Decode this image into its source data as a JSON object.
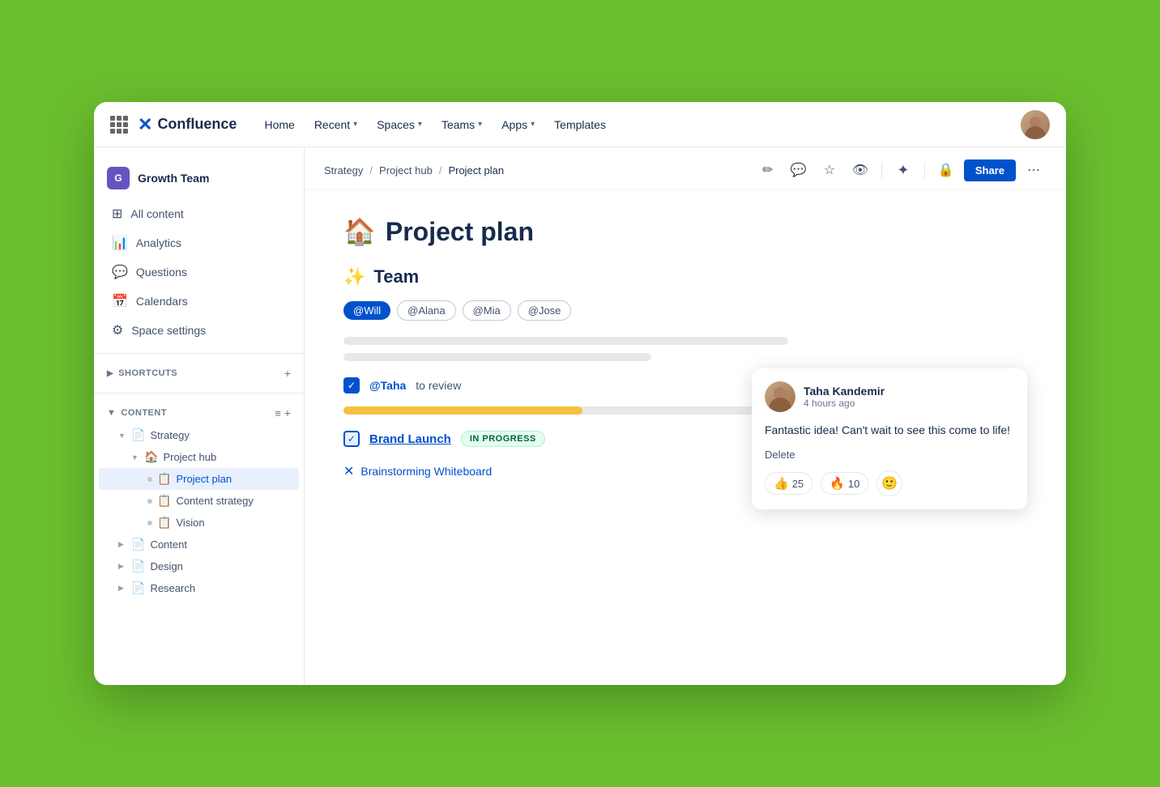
{
  "app": {
    "name": "Confluence",
    "logo_symbol": "✕"
  },
  "topnav": {
    "grid_label": "App grid",
    "nav_items": [
      {
        "label": "Home",
        "has_chevron": false
      },
      {
        "label": "Recent",
        "has_chevron": true
      },
      {
        "label": "Spaces",
        "has_chevron": true
      },
      {
        "label": "Teams",
        "has_chevron": true
      },
      {
        "label": "Apps",
        "has_chevron": true
      },
      {
        "label": "Templates",
        "has_chevron": false
      }
    ]
  },
  "sidebar": {
    "space_name": "Growth Team",
    "space_initial": "G",
    "nav_items": [
      {
        "icon": "⊞",
        "label": "All content"
      },
      {
        "icon": "📊",
        "label": "Analytics"
      },
      {
        "icon": "💬",
        "label": "Questions"
      },
      {
        "icon": "📅",
        "label": "Calendars"
      },
      {
        "icon": "⚙",
        "label": "Space settings"
      }
    ],
    "shortcuts_label": "SHORTCUTS",
    "content_label": "CONTENT",
    "tree": [
      {
        "level": 0,
        "label": "Strategy",
        "emoji": "📄",
        "expanded": true,
        "chevron": "▼"
      },
      {
        "level": 1,
        "label": "Project hub",
        "emoji": "🏠",
        "expanded": true,
        "chevron": "▼"
      },
      {
        "level": 2,
        "label": "Project plan",
        "emoji": "📋",
        "active": true
      },
      {
        "level": 2,
        "label": "Content strategy",
        "emoji": "📋"
      },
      {
        "level": 2,
        "label": "Vision",
        "emoji": "📋"
      },
      {
        "level": 0,
        "label": "Content",
        "emoji": "📄",
        "expanded": false,
        "chevron": "▶"
      },
      {
        "level": 0,
        "label": "Design",
        "emoji": "📄",
        "expanded": false,
        "chevron": "▶"
      },
      {
        "level": 0,
        "label": "Research",
        "emoji": "📄",
        "expanded": false,
        "chevron": "▶"
      }
    ]
  },
  "breadcrumb": {
    "items": [
      "Strategy",
      "Project hub",
      "Project plan"
    ]
  },
  "toolbar": {
    "edit_icon": "✏",
    "comment_icon": "💬",
    "star_icon": "☆",
    "eye_icon": "👁",
    "spark_icon": "✦",
    "lock_icon": "🔒",
    "share_label": "Share",
    "more_icon": "⋯"
  },
  "page": {
    "title_emoji": "🏠",
    "title": "Project plan",
    "team_section_emoji": "✨",
    "team_section_title": "Team",
    "team_members": [
      "@Will",
      "@Alana",
      "@Mia",
      "@Jose"
    ],
    "line1_width": "65%",
    "line2_width": "45%",
    "task": {
      "mention": "@Taha",
      "text": " to review"
    },
    "progress_line1_width": "35%",
    "progress_line1_color": "#f6c142",
    "progress_line2_width": "100%",
    "progress_line2_color": "#e8e8e8",
    "brand_launch": {
      "label": "Brand Launch",
      "status": "IN PROGRESS"
    },
    "whiteboard_link": "Brainstorming Whiteboard"
  },
  "comment": {
    "author": "Taha Kandemir",
    "time": "4 hours ago",
    "text": "Fantastic idea! Can't wait to see this come to life!",
    "delete_label": "Delete",
    "reactions": [
      {
        "emoji": "👍",
        "count": 25
      },
      {
        "emoji": "🔥",
        "count": 10
      }
    ],
    "add_reaction_icon": "😊"
  }
}
